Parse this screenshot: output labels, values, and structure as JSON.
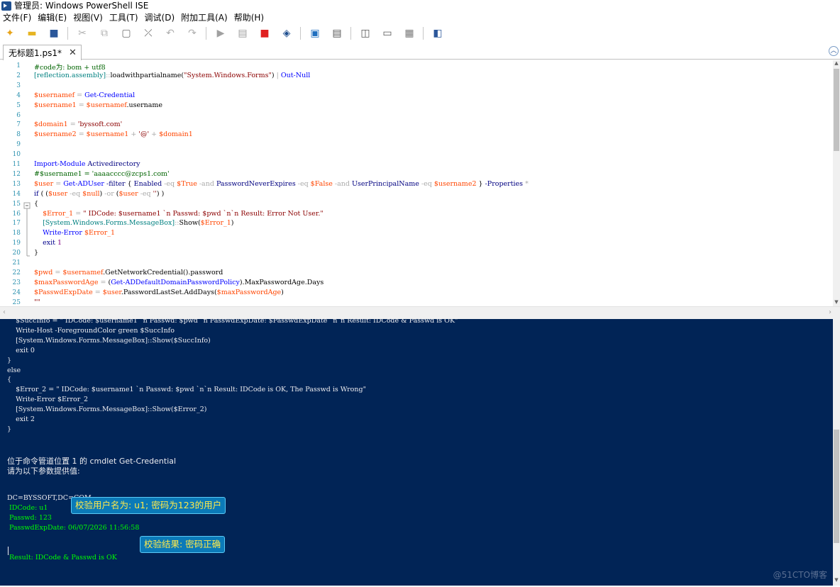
{
  "window": {
    "title": "管理员: Windows PowerShell ISE"
  },
  "menu": [
    "文件(F)",
    "编辑(E)",
    "视图(V)",
    "工具(T)",
    "调试(D)",
    "附加工具(A)",
    "帮助(H)"
  ],
  "toolbar": {
    "buttons": [
      {
        "name": "new-file-icon",
        "glyph": "✦",
        "color": "#e8a317"
      },
      {
        "name": "open-folder-icon",
        "glyph": "▬",
        "color": "#e6b422"
      },
      {
        "name": "save-icon",
        "glyph": "■",
        "color": "#2b579a"
      },
      {
        "name": "cut-icon",
        "glyph": "✂",
        "color": "#b0b0b0"
      },
      {
        "name": "copy-icon",
        "glyph": "⧉",
        "color": "#b0b0b0"
      },
      {
        "name": "paste-icon",
        "glyph": "▢",
        "color": "#707070"
      },
      {
        "name": "clear-console-icon",
        "glyph": "⤫",
        "color": "#606060"
      },
      {
        "name": "undo-icon",
        "glyph": "↶",
        "color": "#b0b0b0"
      },
      {
        "name": "redo-icon",
        "glyph": "↷",
        "color": "#b0b0b0"
      },
      {
        "name": "run-script-icon",
        "glyph": "▶",
        "color": "#a0a0a0"
      },
      {
        "name": "run-selection-icon",
        "glyph": "▤",
        "color": "#a0a0a0"
      },
      {
        "name": "stop-icon",
        "glyph": "■",
        "color": "#e02020"
      },
      {
        "name": "remote-powershell-icon",
        "glyph": "◈",
        "color": "#1f4f8f"
      },
      {
        "name": "powershell-console-icon",
        "glyph": "▣",
        "color": "#1f6fbf"
      },
      {
        "name": "show-script-top-icon",
        "glyph": "▤",
        "color": "#555555"
      },
      {
        "name": "show-script-right-icon",
        "glyph": "◫",
        "color": "#555555"
      },
      {
        "name": "show-script-max-icon",
        "glyph": "▭",
        "color": "#555555"
      },
      {
        "name": "show-command-window-icon",
        "glyph": "▦",
        "color": "#777777"
      },
      {
        "name": "show-command-addon-icon",
        "glyph": "◧",
        "color": "#2b579a"
      }
    ]
  },
  "tab": {
    "label": "无标题1.ps1*",
    "close": "✕"
  },
  "editor": {
    "line_numbers": [
      "1",
      "2",
      "3",
      "4",
      "5",
      "6",
      "7",
      "8",
      "9",
      "10",
      "11",
      "12",
      "13",
      "14",
      "15",
      "16",
      "17",
      "18",
      "19",
      "20",
      "21",
      "22",
      "23",
      "24",
      "25"
    ],
    "lines": [
      [
        [
          "cm",
          "#code为: bom + utf8"
        ]
      ],
      [
        [
          "ty",
          "[reflection.assembly]"
        ],
        [
          "op",
          "::"
        ],
        [
          "mem",
          "loadwithpartialname("
        ],
        [
          "str",
          "\"System.Windows.Forms\""
        ],
        [
          "mem",
          ") "
        ],
        [
          "op",
          "| "
        ],
        [
          "cmd",
          "Out-Null"
        ]
      ],
      [],
      [
        [
          "var",
          "$usernamef"
        ],
        [
          "op",
          " = "
        ],
        [
          "cmd",
          "Get-Credential"
        ]
      ],
      [
        [
          "var",
          "$username1"
        ],
        [
          "op",
          " = "
        ],
        [
          "var",
          "$usernamef"
        ],
        [
          "mem",
          ".username"
        ]
      ],
      [],
      [
        [
          "var",
          "$domain1"
        ],
        [
          "op",
          " = "
        ],
        [
          "str",
          "'byssoft.com'"
        ]
      ],
      [
        [
          "var",
          "$username2"
        ],
        [
          "op",
          " = "
        ],
        [
          "var",
          "$username1"
        ],
        [
          "op",
          " + "
        ],
        [
          "str",
          "'@'"
        ],
        [
          "op",
          " + "
        ],
        [
          "var",
          "$domain1"
        ]
      ],
      [],
      [],
      [
        [
          "cmd",
          "Import-Module "
        ],
        [
          "prm",
          "Activedirectory"
        ]
      ],
      [
        [
          "cm",
          "#$username1 = 'aaaacccc@zcps1.com'"
        ]
      ],
      [
        [
          "var",
          "$user"
        ],
        [
          "op",
          " = "
        ],
        [
          "cmd",
          "Get-ADUser "
        ],
        [
          "prm",
          "-filter "
        ],
        [
          "mem",
          "{ "
        ],
        [
          "prm",
          "Enabled "
        ],
        [
          "op",
          "-eq "
        ],
        [
          "var",
          "$True "
        ],
        [
          "op",
          "-and "
        ],
        [
          "prm",
          "PasswordNeverExpires "
        ],
        [
          "op",
          "-eq "
        ],
        [
          "var",
          "$False "
        ],
        [
          "op",
          "-and "
        ],
        [
          "prm",
          "UserPrincipalName "
        ],
        [
          "op",
          "-eq "
        ],
        [
          "var",
          "$username2"
        ],
        [
          "mem",
          " } "
        ],
        [
          "prm",
          "-Properties "
        ],
        [
          "op",
          "*"
        ]
      ],
      [
        [
          "kw",
          "if"
        ],
        [
          "mem",
          " ( ("
        ],
        [
          "var",
          "$user"
        ],
        [
          "op",
          " -eq "
        ],
        [
          "var",
          "$null"
        ],
        [
          "mem",
          ") "
        ],
        [
          "op",
          "-or "
        ],
        [
          "mem",
          "("
        ],
        [
          "var",
          "$user"
        ],
        [
          "op",
          " -eq "
        ],
        [
          "str",
          "''"
        ],
        [
          "mem",
          ") )"
        ]
      ],
      [
        [
          "mem",
          "{"
        ]
      ],
      [
        [
          "mem",
          "    "
        ],
        [
          "var",
          "$Error_1"
        ],
        [
          "op",
          " = "
        ],
        [
          "str",
          "\" IDCode: $username1 `n Passwd: $pwd `n`n Result: Error Not User.\""
        ]
      ],
      [
        [
          "mem",
          "    "
        ],
        [
          "ty",
          "[System.Windows.Forms.MessageBox]"
        ],
        [
          "op",
          "::"
        ],
        [
          "mem",
          "Show("
        ],
        [
          "var",
          "$Error_1"
        ],
        [
          "mem",
          ")"
        ]
      ],
      [
        [
          "mem",
          "    "
        ],
        [
          "cmd",
          "Write-Error "
        ],
        [
          "var",
          "$Error_1"
        ]
      ],
      [
        [
          "mem",
          "    "
        ],
        [
          "kw",
          "exit "
        ],
        [
          "num",
          "1"
        ]
      ],
      [
        [
          "mem",
          "}"
        ]
      ],
      [],
      [
        [
          "var",
          "$pwd"
        ],
        [
          "op",
          " = "
        ],
        [
          "var",
          "$usernamef"
        ],
        [
          "mem",
          ".GetNetworkCredential().password"
        ]
      ],
      [
        [
          "var",
          "$maxPasswordAge"
        ],
        [
          "op",
          " = "
        ],
        [
          "mem",
          "("
        ],
        [
          "cmd",
          "Get-ADDefaultDomainPasswordPolicy"
        ],
        [
          "mem",
          ").MaxPasswordAge.Days"
        ]
      ],
      [
        [
          "var",
          "$PasswdExpDate"
        ],
        [
          "op",
          " = "
        ],
        [
          "var",
          "$user"
        ],
        [
          "mem",
          ".PasswordLastSet.AddDays("
        ],
        [
          "var",
          "$maxPasswordAge"
        ],
        [
          "mem",
          ")"
        ]
      ],
      [
        [
          "str",
          "\"\""
        ]
      ]
    ]
  },
  "console": {
    "lines": [
      {
        "text": "    $SuccInfo = \" IDCode: $username1 `n Passwd: $pwd `n PasswdExpDate: $PasswdExpDate `n`n Result: IDCode & Passwd is OK\"",
        "kind": "code"
      },
      {
        "text": "    Write-Host -ForegroundColor green $SuccInfo",
        "kind": "code"
      },
      {
        "text": "    [System.Windows.Forms.MessageBox]::Show($SuccInfo)",
        "kind": "code"
      },
      {
        "text": "    exit 0",
        "kind": "code"
      },
      {
        "text": "}",
        "kind": "code"
      },
      {
        "text": "else",
        "kind": "code"
      },
      {
        "text": "{",
        "kind": "code"
      },
      {
        "text": "    $Error_2 = \" IDCode: $username1 `n Passwd: $pwd `n`n Result: IDCode is OK, The Passwd is Wrong\"",
        "kind": "code"
      },
      {
        "text": "    Write-Error $Error_2",
        "kind": "code"
      },
      {
        "text": "    [System.Windows.Forms.MessageBox]::Show($Error_2)",
        "kind": "code"
      },
      {
        "text": "    exit 2",
        "kind": "code"
      },
      {
        "text": "}",
        "kind": "code"
      },
      {
        "text": "",
        "kind": "code"
      },
      {
        "text": "",
        "kind": "code"
      },
      {
        "text": "位于命令管道位置 1 的 cmdlet Get-Credential",
        "kind": "cn"
      },
      {
        "text": "请为以下参数提供值:",
        "kind": "cn"
      },
      {
        "text": "",
        "kind": "code"
      },
      {
        "text": "",
        "kind": "code"
      },
      {
        "text": "DC=BYSSOFT,DC=COM",
        "kind": "code"
      },
      {
        "text": " IDCode: u1",
        "kind": "green"
      },
      {
        "text": " Passwd: 123",
        "kind": "green"
      },
      {
        "text": " PasswdExpDate: 06/07/2026 11:56:58",
        "kind": "green"
      },
      {
        "text": "",
        "kind": "code"
      },
      {
        "text": "",
        "kind": "code"
      },
      {
        "text": " Result: IDCode & Passwd is OK",
        "kind": "green"
      }
    ],
    "annotations": {
      "check_user": "校验用户名为: u1; 密码为123的用户",
      "check_result": "校验结果: 密码正确"
    },
    "watermark": "@51CTO博客"
  }
}
